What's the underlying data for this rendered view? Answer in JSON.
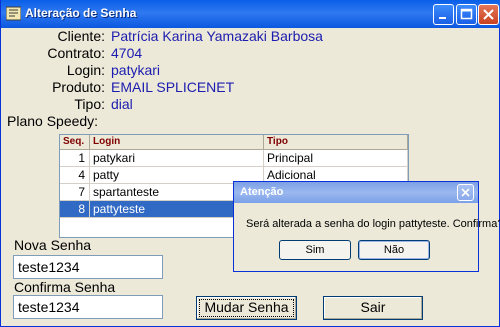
{
  "window": {
    "title": "Alteração de Senha",
    "colors": {
      "titlebar": "#0a5fe8",
      "value_text": "#1c1cb0",
      "header_text": "#800000",
      "selection": "#316ac5"
    }
  },
  "fields": {
    "cliente_label": "Cliente:",
    "cliente_value": "Patrícia Karina Yamazaki Barbosa",
    "contrato_label": "Contrato:",
    "contrato_value": "4704",
    "login_label": "Login:",
    "login_value": "patykari",
    "produto_label": "Produto:",
    "produto_value": "EMAIL SPLICENET",
    "tipo_label": "Tipo:",
    "tipo_value": "dial",
    "plano_label": "Plano Speedy:"
  },
  "grid": {
    "columns": [
      "Seq.",
      "Login",
      "Tipo"
    ],
    "rows": [
      {
        "seq": "1",
        "login": "patykari",
        "tipo": "Principal"
      },
      {
        "seq": "4",
        "login": "patty",
        "tipo": "Adicional"
      },
      {
        "seq": "7",
        "login": "spartanteste",
        "tipo": ""
      },
      {
        "seq": "8",
        "login": "pattyteste",
        "tipo": ""
      }
    ],
    "selected_row": 3
  },
  "form": {
    "nova_senha_label": "Nova Senha",
    "nova_senha_value": "teste1234",
    "confirma_senha_label": "Confirma Senha",
    "confirma_senha_value": "teste1234",
    "mudar_senha_label": "Mudar Senha",
    "sair_label": "Sair"
  },
  "dialog": {
    "title": "Atenção",
    "message": "Será alterada a senha do login pattyteste. Confirma?",
    "yes_label": "Sim",
    "no_label": "Não"
  }
}
